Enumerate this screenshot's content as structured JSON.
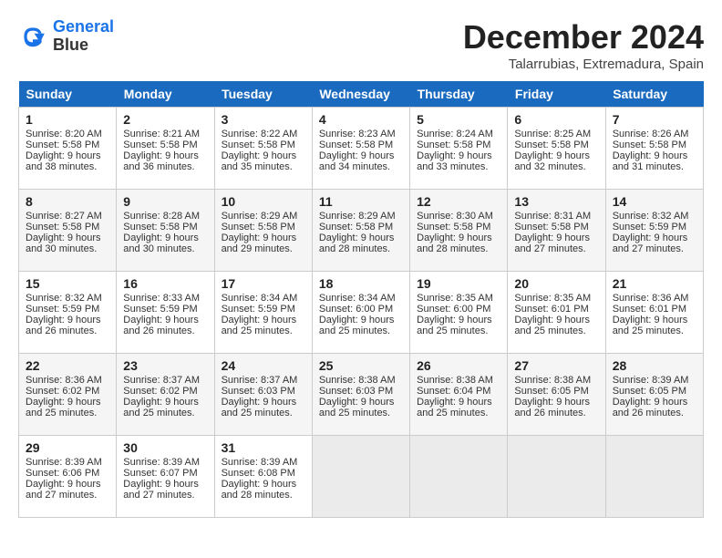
{
  "header": {
    "logo_line1": "General",
    "logo_line2": "Blue",
    "month": "December 2024",
    "location": "Talarrubias, Extremadura, Spain"
  },
  "weekdays": [
    "Sunday",
    "Monday",
    "Tuesday",
    "Wednesday",
    "Thursday",
    "Friday",
    "Saturday"
  ],
  "weeks": [
    [
      {
        "day": "1",
        "sunrise": "Sunrise: 8:20 AM",
        "sunset": "Sunset: 5:58 PM",
        "daylight": "Daylight: 9 hours and 38 minutes."
      },
      {
        "day": "2",
        "sunrise": "Sunrise: 8:21 AM",
        "sunset": "Sunset: 5:58 PM",
        "daylight": "Daylight: 9 hours and 36 minutes."
      },
      {
        "day": "3",
        "sunrise": "Sunrise: 8:22 AM",
        "sunset": "Sunset: 5:58 PM",
        "daylight": "Daylight: 9 hours and 35 minutes."
      },
      {
        "day": "4",
        "sunrise": "Sunrise: 8:23 AM",
        "sunset": "Sunset: 5:58 PM",
        "daylight": "Daylight: 9 hours and 34 minutes."
      },
      {
        "day": "5",
        "sunrise": "Sunrise: 8:24 AM",
        "sunset": "Sunset: 5:58 PM",
        "daylight": "Daylight: 9 hours and 33 minutes."
      },
      {
        "day": "6",
        "sunrise": "Sunrise: 8:25 AM",
        "sunset": "Sunset: 5:58 PM",
        "daylight": "Daylight: 9 hours and 32 minutes."
      },
      {
        "day": "7",
        "sunrise": "Sunrise: 8:26 AM",
        "sunset": "Sunset: 5:58 PM",
        "daylight": "Daylight: 9 hours and 31 minutes."
      }
    ],
    [
      {
        "day": "8",
        "sunrise": "Sunrise: 8:27 AM",
        "sunset": "Sunset: 5:58 PM",
        "daylight": "Daylight: 9 hours and 30 minutes."
      },
      {
        "day": "9",
        "sunrise": "Sunrise: 8:28 AM",
        "sunset": "Sunset: 5:58 PM",
        "daylight": "Daylight: 9 hours and 30 minutes."
      },
      {
        "day": "10",
        "sunrise": "Sunrise: 8:29 AM",
        "sunset": "Sunset: 5:58 PM",
        "daylight": "Daylight: 9 hours and 29 minutes."
      },
      {
        "day": "11",
        "sunrise": "Sunrise: 8:29 AM",
        "sunset": "Sunset: 5:58 PM",
        "daylight": "Daylight: 9 hours and 28 minutes."
      },
      {
        "day": "12",
        "sunrise": "Sunrise: 8:30 AM",
        "sunset": "Sunset: 5:58 PM",
        "daylight": "Daylight: 9 hours and 28 minutes."
      },
      {
        "day": "13",
        "sunrise": "Sunrise: 8:31 AM",
        "sunset": "Sunset: 5:58 PM",
        "daylight": "Daylight: 9 hours and 27 minutes."
      },
      {
        "day": "14",
        "sunrise": "Sunrise: 8:32 AM",
        "sunset": "Sunset: 5:59 PM",
        "daylight": "Daylight: 9 hours and 27 minutes."
      }
    ],
    [
      {
        "day": "15",
        "sunrise": "Sunrise: 8:32 AM",
        "sunset": "Sunset: 5:59 PM",
        "daylight": "Daylight: 9 hours and 26 minutes."
      },
      {
        "day": "16",
        "sunrise": "Sunrise: 8:33 AM",
        "sunset": "Sunset: 5:59 PM",
        "daylight": "Daylight: 9 hours and 26 minutes."
      },
      {
        "day": "17",
        "sunrise": "Sunrise: 8:34 AM",
        "sunset": "Sunset: 5:59 PM",
        "daylight": "Daylight: 9 hours and 25 minutes."
      },
      {
        "day": "18",
        "sunrise": "Sunrise: 8:34 AM",
        "sunset": "Sunset: 6:00 PM",
        "daylight": "Daylight: 9 hours and 25 minutes."
      },
      {
        "day": "19",
        "sunrise": "Sunrise: 8:35 AM",
        "sunset": "Sunset: 6:00 PM",
        "daylight": "Daylight: 9 hours and 25 minutes."
      },
      {
        "day": "20",
        "sunrise": "Sunrise: 8:35 AM",
        "sunset": "Sunset: 6:01 PM",
        "daylight": "Daylight: 9 hours and 25 minutes."
      },
      {
        "day": "21",
        "sunrise": "Sunrise: 8:36 AM",
        "sunset": "Sunset: 6:01 PM",
        "daylight": "Daylight: 9 hours and 25 minutes."
      }
    ],
    [
      {
        "day": "22",
        "sunrise": "Sunrise: 8:36 AM",
        "sunset": "Sunset: 6:02 PM",
        "daylight": "Daylight: 9 hours and 25 minutes."
      },
      {
        "day": "23",
        "sunrise": "Sunrise: 8:37 AM",
        "sunset": "Sunset: 6:02 PM",
        "daylight": "Daylight: 9 hours and 25 minutes."
      },
      {
        "day": "24",
        "sunrise": "Sunrise: 8:37 AM",
        "sunset": "Sunset: 6:03 PM",
        "daylight": "Daylight: 9 hours and 25 minutes."
      },
      {
        "day": "25",
        "sunrise": "Sunrise: 8:38 AM",
        "sunset": "Sunset: 6:03 PM",
        "daylight": "Daylight: 9 hours and 25 minutes."
      },
      {
        "day": "26",
        "sunrise": "Sunrise: 8:38 AM",
        "sunset": "Sunset: 6:04 PM",
        "daylight": "Daylight: 9 hours and 25 minutes."
      },
      {
        "day": "27",
        "sunrise": "Sunrise: 8:38 AM",
        "sunset": "Sunset: 6:05 PM",
        "daylight": "Daylight: 9 hours and 26 minutes."
      },
      {
        "day": "28",
        "sunrise": "Sunrise: 8:39 AM",
        "sunset": "Sunset: 6:05 PM",
        "daylight": "Daylight: 9 hours and 26 minutes."
      }
    ],
    [
      {
        "day": "29",
        "sunrise": "Sunrise: 8:39 AM",
        "sunset": "Sunset: 6:06 PM",
        "daylight": "Daylight: 9 hours and 27 minutes."
      },
      {
        "day": "30",
        "sunrise": "Sunrise: 8:39 AM",
        "sunset": "Sunset: 6:07 PM",
        "daylight": "Daylight: 9 hours and 27 minutes."
      },
      {
        "day": "31",
        "sunrise": "Sunrise: 8:39 AM",
        "sunset": "Sunset: 6:08 PM",
        "daylight": "Daylight: 9 hours and 28 minutes."
      },
      null,
      null,
      null,
      null
    ]
  ]
}
